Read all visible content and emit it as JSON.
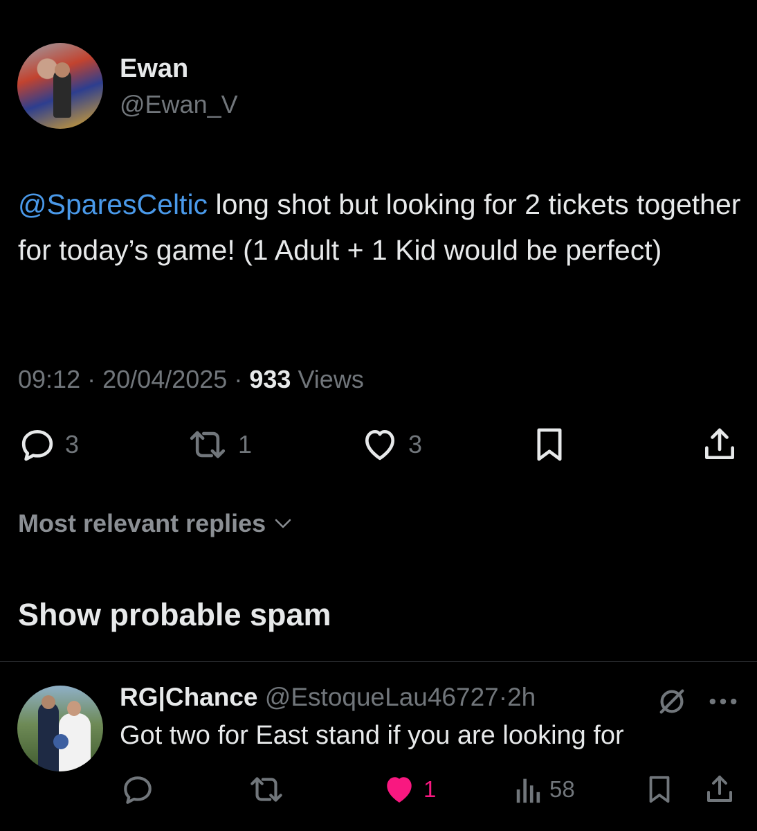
{
  "tweet": {
    "author_name": "Ewan",
    "author_handle": "@Ewan_V",
    "mention": "@SparesCeltic",
    "text": " long shot but looking for 2 tickets together for today’s game! (1 Adult + 1 Kid would be perfect)",
    "time": "09:12",
    "separator": "·",
    "date": "20/04/2025",
    "views_count": "933",
    "views_label": "Views",
    "replies": "3",
    "reposts": "1",
    "likes": "3"
  },
  "replies_section": {
    "sort_label": "Most relevant replies",
    "spam_label": "Show probable spam"
  },
  "reply": {
    "author_name": "RG|Chance",
    "author_handle": "@EstoqueLau46727",
    "separator": "·",
    "time": "2h",
    "text": "Got two for East stand if you are looking for",
    "likes": "1",
    "views": "58"
  },
  "colors": {
    "background": "#000000",
    "text": "#e7e9ea",
    "muted": "#71767b",
    "link": "#4a99e9",
    "like": "#f91880"
  },
  "icons": {
    "reply": "reply-icon",
    "repost": "repost-icon",
    "like": "heart-icon",
    "bookmark": "bookmark-icon",
    "share": "share-icon",
    "views": "views-icon",
    "grok": "slashed-circle-icon",
    "more": "more-icon",
    "chevron": "chevron-down-icon"
  }
}
